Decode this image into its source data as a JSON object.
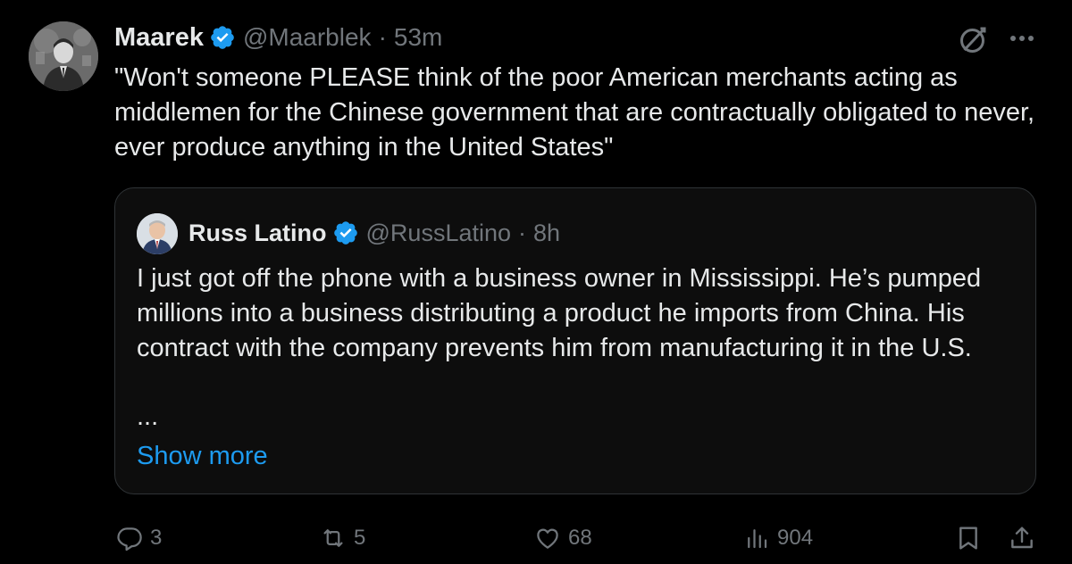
{
  "author": {
    "name": "Maarek",
    "handle": "@Maarblek",
    "time": "53m"
  },
  "tweet_text": "\"Won't someone PLEASE think of the poor American merchants acting as middlemen for the Chinese government that are contractually obligated to never, ever produce anything in the United States\"",
  "quote": {
    "name": "Russ Latino",
    "handle": "@RussLatino",
    "time": "8h",
    "text": "I just got off the phone with a business owner in Mississippi. He’s pumped millions into a business distributing a product he imports from China. His contract with the company prevents him from manufacturing it in the U.S.",
    "ellipsis": "...",
    "show_more": "Show more"
  },
  "actions": {
    "replies": "3",
    "reposts": "5",
    "likes": "68",
    "views": "904"
  },
  "separator": "·",
  "colors": {
    "background": "#000000",
    "text": "#e7e9ea",
    "muted": "#71767b",
    "link": "#1d9bf0",
    "verified": "#1d9bf0",
    "border": "#2f3336"
  },
  "icons": {
    "verified": "verified-badge-icon",
    "grok": "grok-icon",
    "more": "more-options-icon",
    "reply": "reply-icon",
    "repost": "repost-icon",
    "like": "like-icon",
    "views": "views-icon",
    "bookmark": "bookmark-icon",
    "share": "share-icon"
  }
}
